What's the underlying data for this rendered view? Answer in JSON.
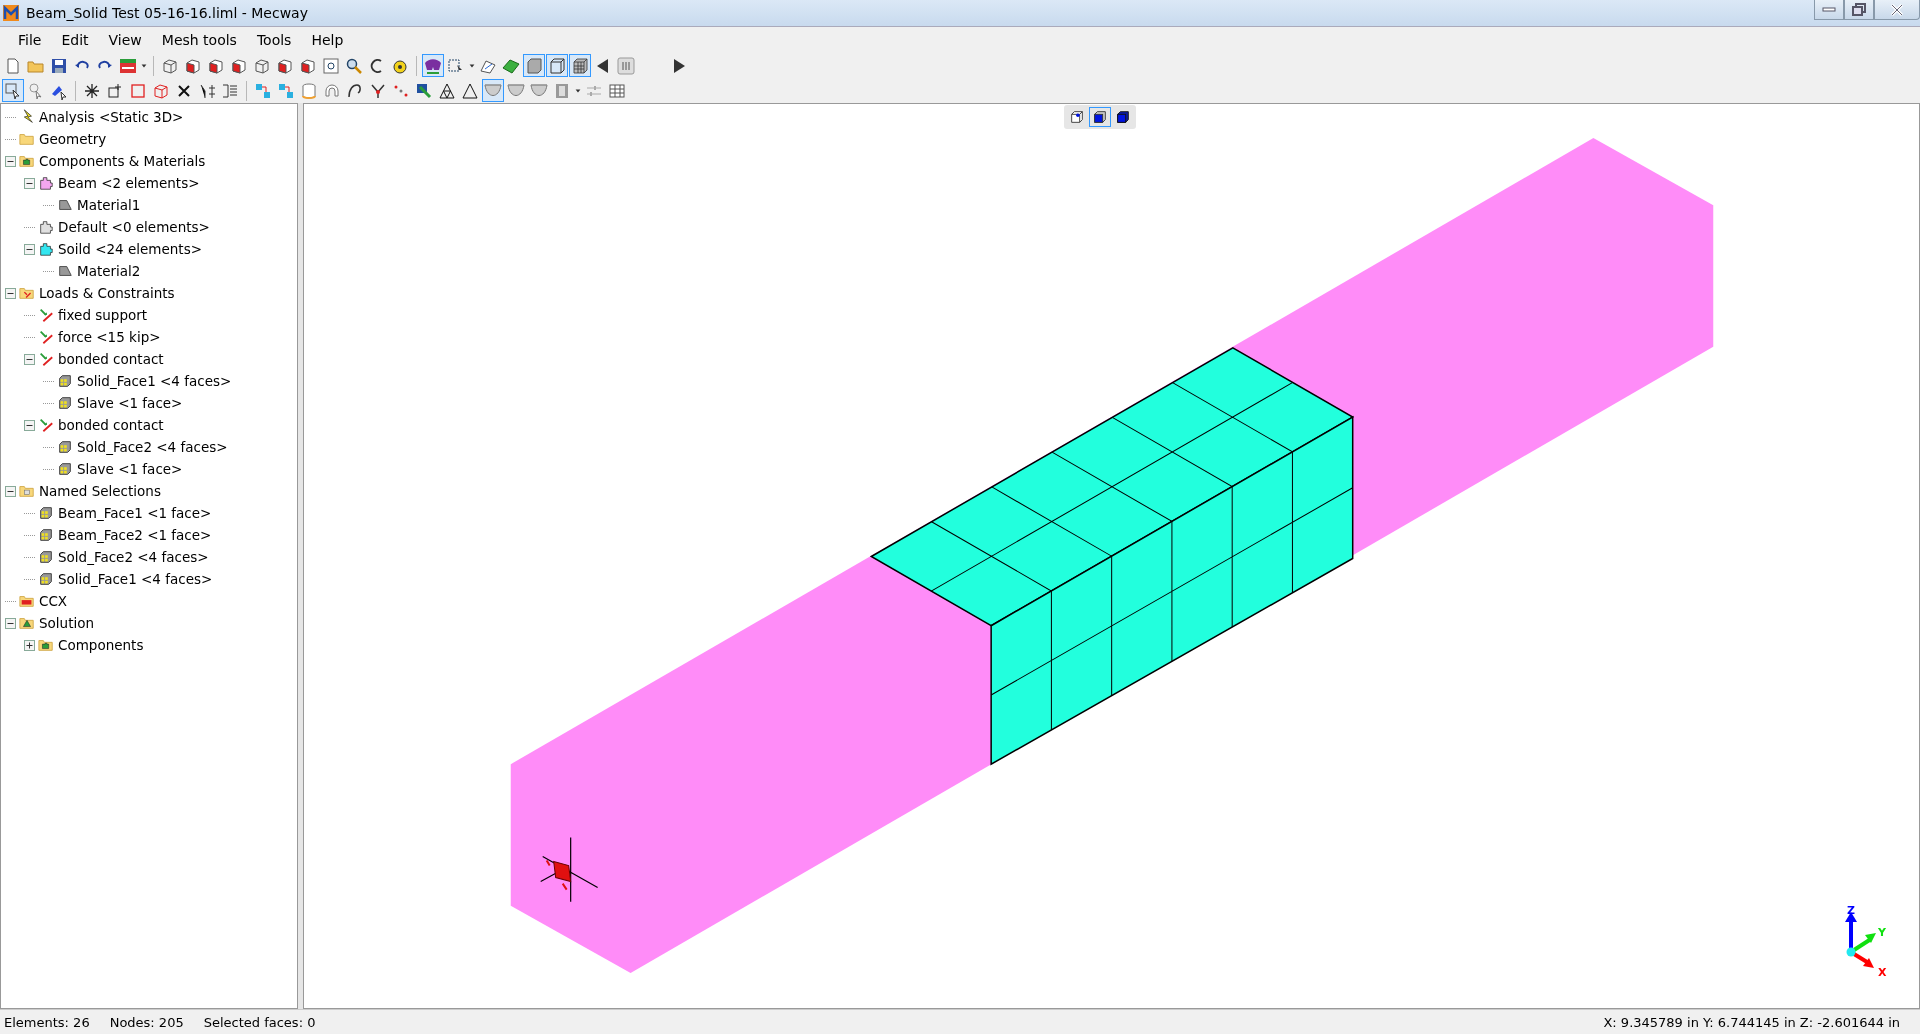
{
  "window": {
    "title": "Beam_Solid Test 05-16-16.liml - Mecway"
  },
  "menu": [
    "File",
    "Edit",
    "View",
    "Mesh tools",
    "Tools",
    "Help"
  ],
  "toolbars": [
    [
      {
        "kind": "doc",
        "selected": false
      },
      {
        "kind": "folder",
        "selected": false
      },
      {
        "kind": "disk",
        "selected": false
      },
      {
        "kind": "undo",
        "selected": false
      },
      {
        "kind": "redo",
        "selected": false
      },
      {
        "kind": "chip",
        "selected": false
      },
      {
        "kind": "dropdown",
        "selected": false
      },
      {
        "kind": "separator",
        "selected": false
      },
      {
        "kind": "cube",
        "selected": false
      },
      {
        "kind": "cube-face",
        "selected": false
      },
      {
        "kind": "cube-face",
        "selected": false
      },
      {
        "kind": "cube-face",
        "selected": false
      },
      {
        "kind": "cube",
        "selected": false
      },
      {
        "kind": "cube-face",
        "selected": false
      },
      {
        "kind": "cube-face",
        "selected": false
      },
      {
        "kind": "zoom-box",
        "selected": false
      },
      {
        "kind": "magnifier",
        "selected": false
      },
      {
        "kind": "rotate",
        "selected": false
      },
      {
        "kind": "tape",
        "selected": false
      },
      {
        "kind": "separator",
        "selected": false
      },
      {
        "kind": "glasses",
        "selected": true
      },
      {
        "kind": "pointer",
        "selected": false
      },
      {
        "kind": "dropdown",
        "selected": false
      },
      {
        "kind": "pen",
        "selected": false
      },
      {
        "kind": "layer",
        "selected": false
      },
      {
        "kind": "shade",
        "selected": true
      },
      {
        "kind": "wire",
        "selected": true
      },
      {
        "kind": "mesh",
        "selected": true
      },
      {
        "kind": "arrow-left",
        "selected": false
      },
      {
        "kind": "thumb",
        "selected": false
      },
      {
        "kind": "arrow-right",
        "selected": false
      }
    ],
    [
      {
        "kind": "select-rect",
        "selected": true
      },
      {
        "kind": "pointer-circle",
        "selected": false
      },
      {
        "kind": "pointer-wand",
        "selected": false
      },
      {
        "kind": "separator",
        "selected": false
      },
      {
        "kind": "star",
        "selected": false
      },
      {
        "kind": "star-box",
        "selected": false
      },
      {
        "kind": "square",
        "selected": false
      },
      {
        "kind": "cube-outline",
        "selected": false
      },
      {
        "kind": "cross",
        "selected": false
      },
      {
        "kind": "dim",
        "selected": false
      },
      {
        "kind": "list",
        "selected": false
      },
      {
        "kind": "separator",
        "selected": false
      },
      {
        "kind": "nodes",
        "selected": false
      },
      {
        "kind": "nodes",
        "selected": false
      },
      {
        "kind": "cylinder",
        "selected": false
      },
      {
        "kind": "arc",
        "selected": false
      },
      {
        "kind": "curve",
        "selected": false
      },
      {
        "kind": "branch",
        "selected": false
      },
      {
        "kind": "dots",
        "selected": false
      },
      {
        "kind": "snap",
        "selected": false
      },
      {
        "kind": "triangle-mesh",
        "selected": false
      },
      {
        "kind": "triangle",
        "selected": false
      },
      {
        "kind": "bowl",
        "selected": true
      },
      {
        "kind": "bowl",
        "selected": false
      },
      {
        "kind": "bowl",
        "selected": false
      },
      {
        "kind": "film",
        "selected": false
      },
      {
        "kind": "dropdown",
        "selected": false
      },
      {
        "kind": "sliders",
        "selected": false
      },
      {
        "kind": "grid",
        "selected": false
      }
    ]
  ],
  "tree": [
    {
      "label": "Analysis <Static 3D>",
      "kind": "analysis"
    },
    {
      "label": "Geometry",
      "kind": "folder"
    },
    {
      "label": "Components & Materials",
      "kind": "components",
      "expanded": true,
      "children": [
        {
          "label": "Beam <2 elements>",
          "kind": "part",
          "color": "#f4a6f0",
          "expanded": true,
          "children": [
            {
              "label": "Material1",
              "kind": "material"
            }
          ]
        },
        {
          "label": "Default <0 elements>",
          "kind": "part",
          "color": "#e0e0e0"
        },
        {
          "label": "Soild <24 elements>",
          "kind": "part",
          "color": "#33e6f0",
          "expanded": true,
          "children": [
            {
              "label": "Material2",
              "kind": "material"
            }
          ]
        }
      ]
    },
    {
      "label": "Loads & Constraints",
      "kind": "loads",
      "expanded": true,
      "children": [
        {
          "label": "fixed support",
          "kind": "constraint"
        },
        {
          "label": "force <15 kip>",
          "kind": "constraint"
        },
        {
          "label": "bonded contact",
          "kind": "constraint",
          "expanded": true,
          "children": [
            {
              "label": "Solid_Face1 <4 faces>",
              "kind": "faceset"
            },
            {
              "label": "Slave <1 face>",
              "kind": "faceset"
            }
          ]
        },
        {
          "label": "bonded contact",
          "kind": "constraint",
          "expanded": true,
          "children": [
            {
              "label": "Sold_Face2 <4 faces>",
              "kind": "faceset"
            },
            {
              "label": "Slave <1 face>",
              "kind": "faceset"
            }
          ]
        }
      ]
    },
    {
      "label": "Named Selections",
      "kind": "selections",
      "expanded": true,
      "children": [
        {
          "label": "Beam_Face1 <1 face>",
          "kind": "faceset"
        },
        {
          "label": "Beam_Face2 <1 face>",
          "kind": "faceset"
        },
        {
          "label": "Sold_Face2 <4 faces>",
          "kind": "faceset"
        },
        {
          "label": "Solid_Face1 <4 faces>",
          "kind": "faceset"
        }
      ]
    },
    {
      "label": "CCX",
      "kind": "ccx"
    },
    {
      "label": "Solution",
      "kind": "solution",
      "expanded": true,
      "children": [
        {
          "label": "Components",
          "kind": "components",
          "expanded": false
        }
      ]
    }
  ],
  "view_buttons": [
    {
      "kind": "wire-cube",
      "selected": false
    },
    {
      "kind": "solid-cube",
      "selected": true
    },
    {
      "kind": "shaded-cube",
      "selected": false
    }
  ],
  "axes": {
    "x": "X",
    "y": "Y",
    "z": "Z"
  },
  "status_bar": {
    "elements": "Elements: 26",
    "nodes": "Nodes: 205",
    "selected_faces": "Selected faces: 0",
    "coordinates": "X: 9.345789 in Y: 6.744145 in Z: -2.601644 in"
  }
}
